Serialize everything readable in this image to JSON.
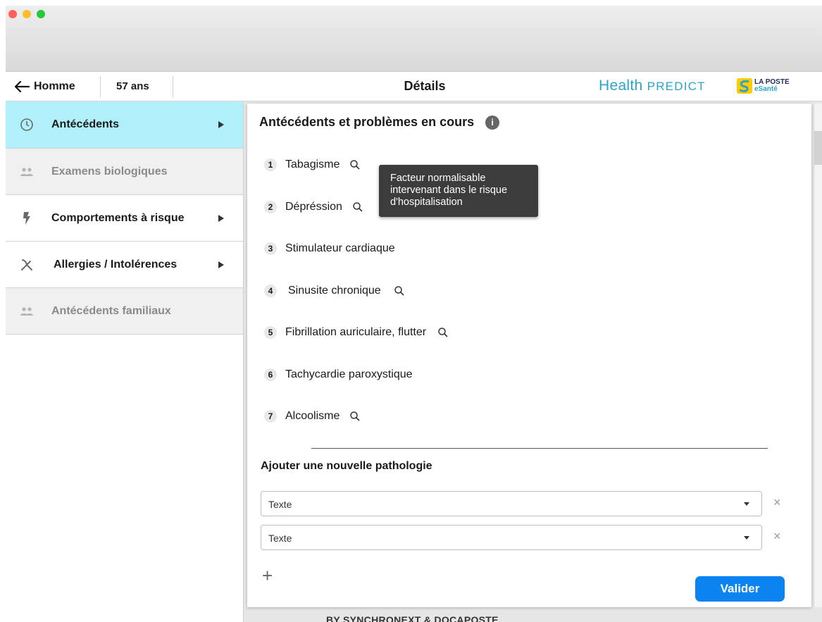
{
  "header": {
    "back_label": "Homme",
    "age": "57 ans",
    "title": "Détails",
    "brand_health": "Health",
    "brand_predict": "PREDICT",
    "laposte_line1": "LA POSTE",
    "laposte_line2": "eSanté"
  },
  "sidebar": {
    "items": [
      {
        "label": "Antécédents",
        "icon": "clock-icon",
        "state": "active"
      },
      {
        "label": "Examens biologiques",
        "icon": "people-icon",
        "state": "disabled"
      },
      {
        "label": "Comportements à risque",
        "icon": "lightning-icon",
        "state": "normal"
      },
      {
        "label": "Allergies / Intolérences",
        "icon": "utensils-icon",
        "state": "normal"
      },
      {
        "label": "Antécédents familiaux",
        "icon": "people-icon",
        "state": "disabled"
      }
    ]
  },
  "main": {
    "title": "Antécédents et problèmes en cours",
    "info_glyph": "i",
    "tooltip": {
      "line1": "Facteur normalisable",
      "line2": "intervenant dans le risque",
      "line3": "d'hospitalisation"
    },
    "pathologies": [
      {
        "num": "1",
        "label": "Tabagisme",
        "has_search": true
      },
      {
        "num": "2",
        "label": "Dépréssion",
        "has_search": true
      },
      {
        "num": "3",
        "label": "Stimulateur cardiaque",
        "has_search": false
      },
      {
        "num": "4",
        "label": "Sinusite chronique",
        "has_search": true
      },
      {
        "num": "5",
        "label": "Fibrillation auriculaire, flutter",
        "has_search": true
      },
      {
        "num": "6",
        "label": "Tachycardie paroxystique",
        "has_search": false
      },
      {
        "num": "7",
        "label": "Alcoolisme",
        "has_search": true
      }
    ],
    "add_title": "Ajouter une nouvelle pathologie",
    "selects": [
      {
        "value": "Texte"
      },
      {
        "value": "Texte"
      }
    ],
    "clear_glyph": "×",
    "plus_glyph": "+",
    "submit_label": "Valider"
  },
  "footer": {
    "text": "BY SYNCHRONEXT & DOCAPOSTE"
  },
  "colors": {
    "accent": "#0b83f0",
    "active_tab": "#aff0fb",
    "brand": "#2aa4c9"
  }
}
